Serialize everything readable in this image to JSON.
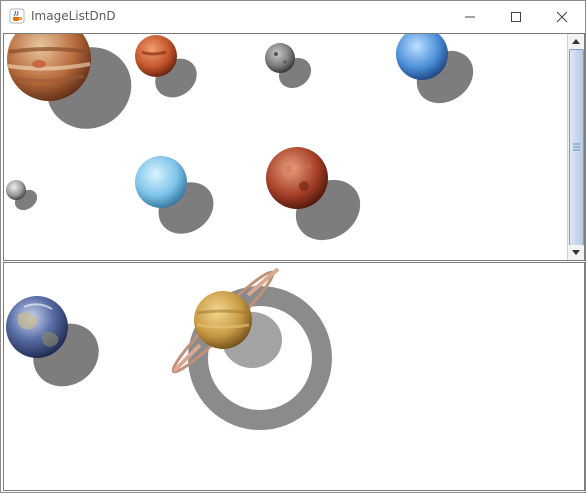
{
  "window": {
    "title": "ImageListDnD",
    "icons": {
      "app": "java-cup-icon",
      "minimize": "minimize-icon",
      "maximize": "maximize-icon",
      "close": "close-icon"
    }
  },
  "top_list": {
    "items": [
      {
        "name": "jupiter"
      },
      {
        "name": "mars"
      },
      {
        "name": "mercury"
      },
      {
        "name": "neptune"
      },
      {
        "name": "moon"
      },
      {
        "name": "uranus"
      },
      {
        "name": "venus"
      }
    ],
    "scrollbar": {
      "icons": [
        "arrow-up-icon",
        "scroll-thumb-grip-icon",
        "arrow-down-icon"
      ]
    }
  },
  "bottom_list": {
    "items": [
      {
        "name": "earth"
      },
      {
        "name": "saturn"
      }
    ]
  }
}
